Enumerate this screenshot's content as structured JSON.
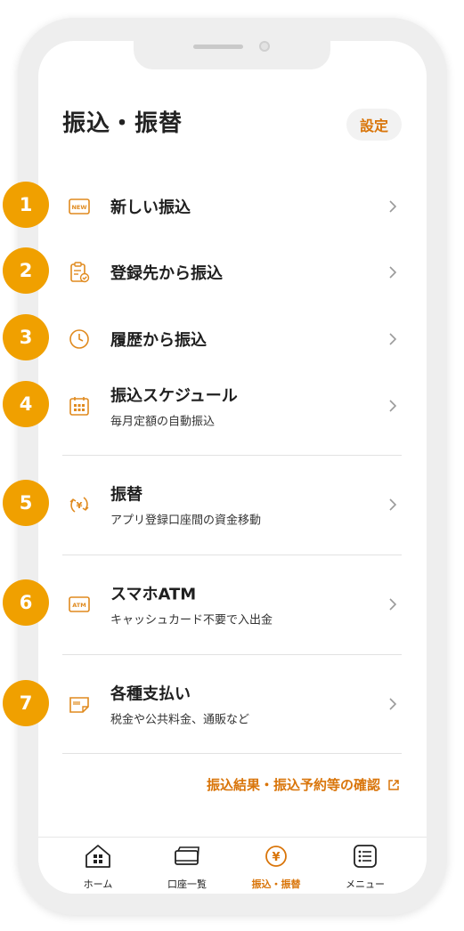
{
  "header": {
    "title": "振込・振替",
    "settings_label": "設定"
  },
  "menu": [
    {
      "badge": "1",
      "icon": "new-icon",
      "label": "新しい振込",
      "sub": ""
    },
    {
      "badge": "2",
      "icon": "clipboard-check-icon",
      "label": "登録先から振込",
      "sub": ""
    },
    {
      "badge": "3",
      "icon": "clock-icon",
      "label": "履歴から振込",
      "sub": ""
    },
    {
      "badge": "4",
      "icon": "calendar-icon",
      "label": "振込スケジュール",
      "sub": "毎月定額の自動振込"
    },
    {
      "badge": "5",
      "icon": "yen-exchange-icon",
      "label": "振替",
      "sub": "アプリ登録口座間の資金移動"
    },
    {
      "badge": "6",
      "icon": "atm-icon",
      "label": "スマホATM",
      "sub": "キャッシュカード不要で入出金"
    },
    {
      "badge": "7",
      "icon": "barcode-payment-icon",
      "label": "各種支払い",
      "sub": "税金や公共料金、通販など"
    }
  ],
  "result_link": {
    "label": "振込結果・振込予約等の確認",
    "icon": "external-link-icon"
  },
  "tabbar": [
    {
      "label": "ホーム",
      "icon": "home-icon",
      "active": false
    },
    {
      "label": "口座一覧",
      "icon": "card-icon",
      "active": false
    },
    {
      "label": "振込・振替",
      "icon": "yen-icon",
      "active": true
    },
    {
      "label": "メニュー",
      "icon": "list-icon",
      "active": false
    }
  ],
  "colors": {
    "accent": "#d9750a",
    "badge": "#f0a000",
    "frame": "#eeeeee"
  }
}
